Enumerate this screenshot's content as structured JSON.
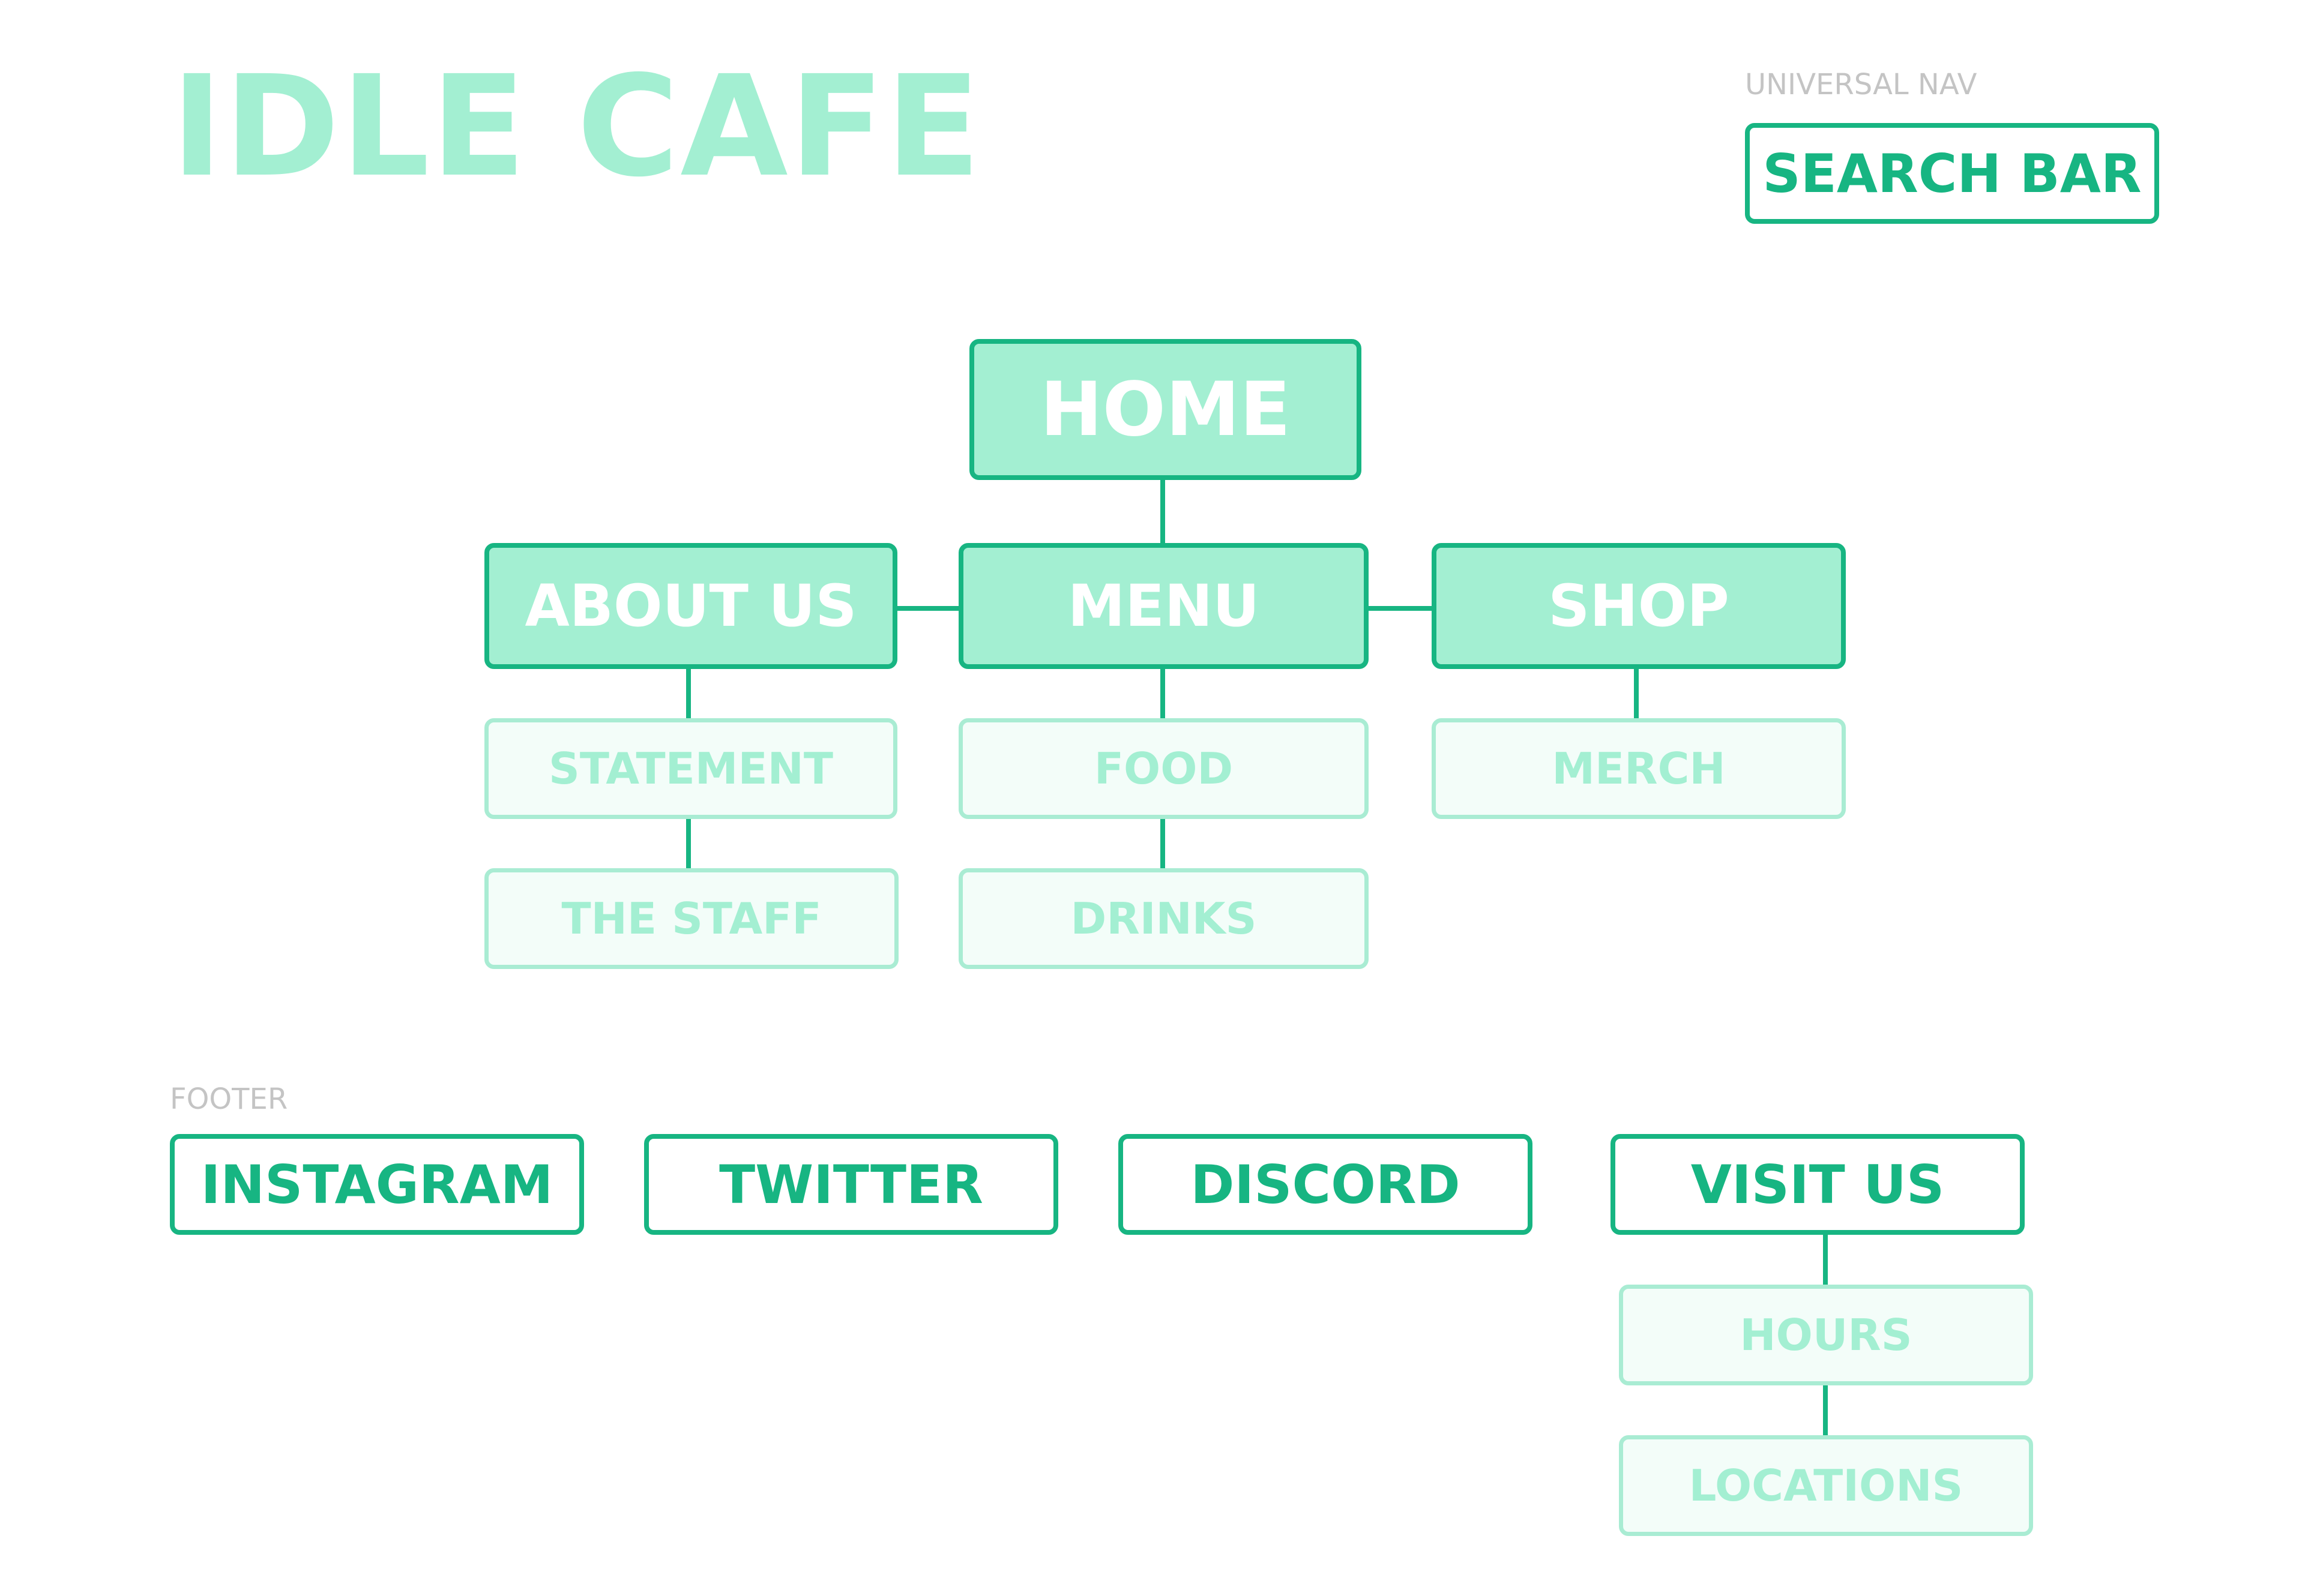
{
  "brand": {
    "title": "IDLE CAFE"
  },
  "universal_nav": {
    "caption": "UNIVERSAL NAV",
    "search_label": "SEARCH BAR"
  },
  "sitemap": {
    "home": "HOME",
    "sections": [
      {
        "label": "ABOUT US",
        "children": [
          "STATEMENT",
          "THE STAFF"
        ]
      },
      {
        "label": "MENU",
        "children": [
          "FOOD",
          "DRINKS"
        ]
      },
      {
        "label": "SHOP",
        "children": [
          "MERCH"
        ]
      }
    ]
  },
  "footer": {
    "caption": "FOOTER",
    "items": [
      {
        "label": "INSTAGRAM"
      },
      {
        "label": "TWITTER"
      },
      {
        "label": "DISCORD"
      },
      {
        "label": "VISIT US",
        "children": [
          "HOURS",
          "LOCATIONS"
        ]
      }
    ]
  },
  "colors": {
    "brand_text": "#a3efd2",
    "accent": "#17b582",
    "primary_fill": "#a3efd2",
    "sub_fill": "#f3fdf9",
    "sub_border": "#a9ecd3",
    "sub_text": "#a3efd2",
    "caption": "#c4c4c4"
  }
}
